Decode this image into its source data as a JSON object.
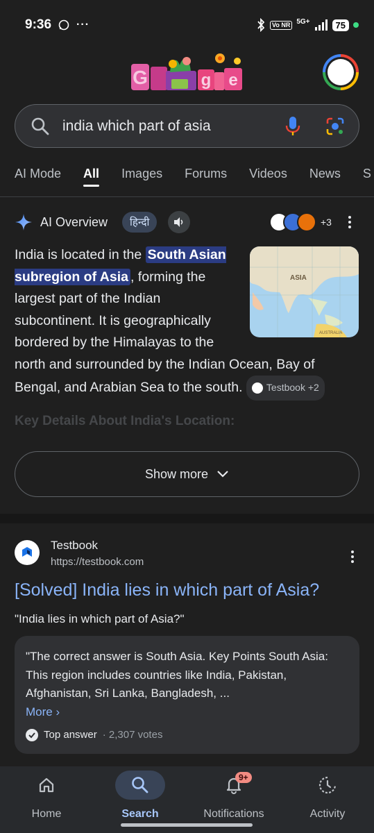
{
  "status": {
    "time": "9:36",
    "volte": "Vo NR",
    "network": "5G+",
    "battery": "75"
  },
  "search": {
    "query": "india which part of asia"
  },
  "tabs": [
    "AI Mode",
    "All",
    "Images",
    "Forums",
    "Videos",
    "News",
    "S"
  ],
  "ai_overview": {
    "title": "AI Overview",
    "hindi_label": "हिन्दी",
    "sources_more": "+3",
    "text_1": "India is located in the ",
    "highlight": "South Asian subregion of Asia",
    "text_2": ", forming the largest part of the Indian subcontinent. It is geographically bordered by the Himalayas to the north and surrounded by the Indian Ocean, Bay of Bengal, and Arabian Sea to the south. ",
    "citation": "Testbook +2",
    "next_heading": "Key Details About India's Location:",
    "show_more": "Show more",
    "map_labels": {
      "asia": "ASIA",
      "australia": "AUSTRALIA"
    }
  },
  "result": {
    "site_name": "Testbook",
    "url": "https://testbook.com",
    "title": "[Solved] India lies in which part of Asia?",
    "snippet": "\"India lies in which part of Asia?\"",
    "answer_text": "\"The correct answer is South Asia. Key Points South Asia: This region includes countries like India, Pakistan, Afghanistan, Sri Lanka, Bangladesh, ...",
    "more": "More ›",
    "top_answer": "Top answer",
    "votes": " · 2,307 votes"
  },
  "nav": {
    "home": "Home",
    "search": "Search",
    "notifications": "Notifications",
    "notifications_badge": "9+",
    "activity": "Activity"
  },
  "colors": {
    "background": "#1f1f1f",
    "link": "#8ab4f8",
    "highlight": "#2b3c83",
    "active_nav": "#a8c7fa"
  }
}
